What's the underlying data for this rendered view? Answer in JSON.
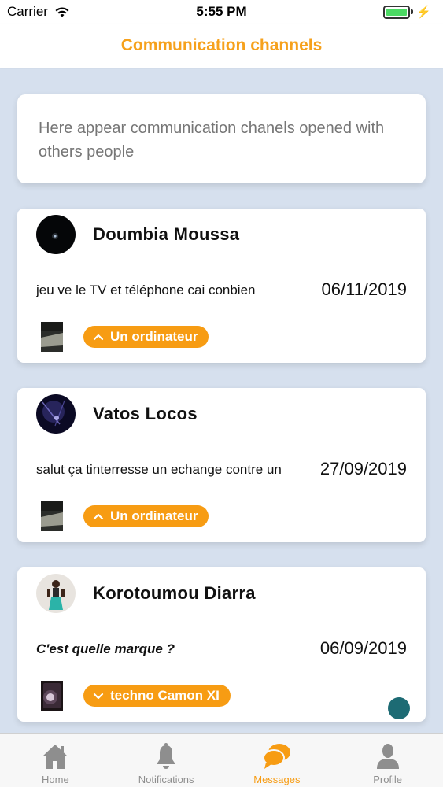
{
  "status_bar": {
    "carrier": "Carrier",
    "time": "5:55 PM"
  },
  "header": {
    "title": "Communication channels"
  },
  "info": {
    "text": "Here appear communication chanels opened with others people"
  },
  "channels": [
    {
      "name": "Doumbia Moussa",
      "message": "jeu ve le TV et téléphone cai conbien",
      "date": "06/11/2019",
      "tag": "Un ordinateur",
      "tag_icon": "chevron-up-icon",
      "italic": false
    },
    {
      "name": "Vatos Locos",
      "message": "salut ça tinterresse un echange contre un",
      "date": "27/09/2019",
      "tag": "Un ordinateur",
      "tag_icon": "chevron-up-icon",
      "italic": false
    },
    {
      "name": "Korotoumou Diarra",
      "message": "C'est quelle marque ?",
      "date": "06/09/2019",
      "tag": "techno Camon XI",
      "tag_icon": "chevron-down-icon",
      "italic": true
    }
  ],
  "tabs": [
    {
      "label": "Home",
      "icon": "home-icon",
      "active": false
    },
    {
      "label": "Notifications",
      "icon": "bell-icon",
      "active": false
    },
    {
      "label": "Messages",
      "icon": "chat-icon",
      "active": true
    },
    {
      "label": "Profile",
      "icon": "user-icon",
      "active": false
    }
  ],
  "colors": {
    "accent": "#f79c13",
    "title": "#f6a11c",
    "background": "#d6e0ee",
    "fab": "#1d6b74"
  }
}
